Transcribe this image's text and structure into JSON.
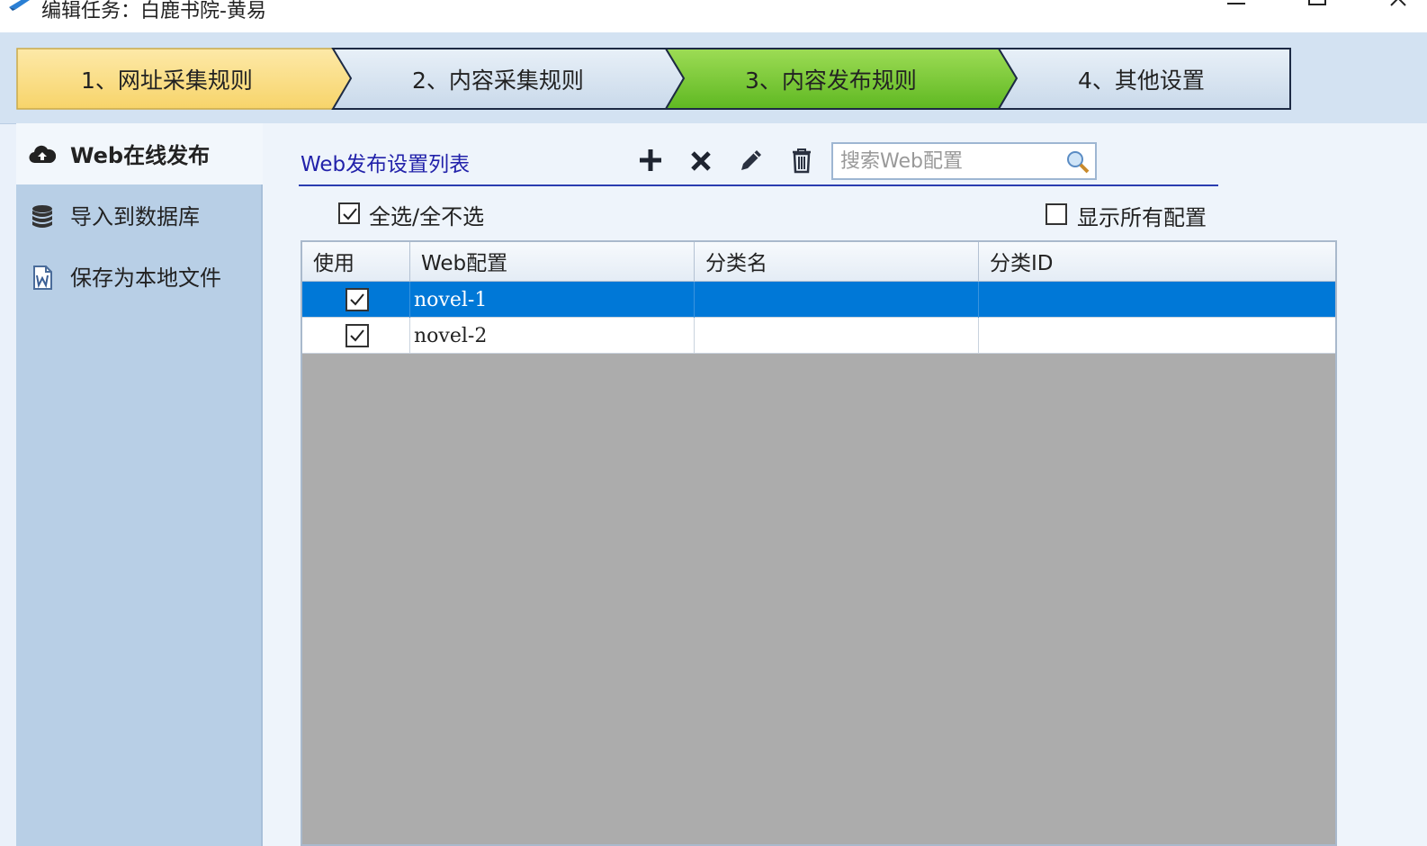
{
  "window": {
    "title": "编辑任务：白鹿书院-黄易"
  },
  "wizard": {
    "steps": [
      {
        "label": "1、网址采集规则",
        "color": "#fbe08a"
      },
      {
        "label": "2、内容采集规则",
        "color": "#d9e6f3"
      },
      {
        "label": "3、内容发布规则",
        "color": "#7cc832"
      },
      {
        "label": "4、其他设置",
        "color": "#d9e6f3"
      }
    ],
    "active_step": 3
  },
  "sidebar": {
    "items": [
      {
        "label": "Web在线发布",
        "icon": "cloud-upload-icon",
        "active": true
      },
      {
        "label": "导入到数据库",
        "icon": "database-icon",
        "active": false
      },
      {
        "label": "保存为本地文件",
        "icon": "word-file-icon",
        "active": false
      }
    ]
  },
  "main": {
    "section_title": "Web发布设置列表",
    "toolbar": {
      "add": "plus-icon",
      "remove": "x-icon",
      "edit": "pencil-icon",
      "delete": "trash-icon"
    },
    "search": {
      "placeholder": "搜索Web配置",
      "value": ""
    },
    "select_all": {
      "label": "全选/全不选",
      "checked": true
    },
    "show_all": {
      "label": "显示所有配置",
      "checked": false
    },
    "table": {
      "columns": [
        "使用",
        "Web配置",
        "分类名",
        "分类ID"
      ],
      "rows": [
        {
          "use": true,
          "web_config": "novel-1",
          "category_name": "",
          "category_id": "",
          "selected": true
        },
        {
          "use": true,
          "web_config": "novel-2",
          "category_name": "",
          "category_id": "",
          "selected": false
        }
      ]
    }
  },
  "colors": {
    "selection": "#0078d7",
    "title_blue": "#2222aa"
  }
}
